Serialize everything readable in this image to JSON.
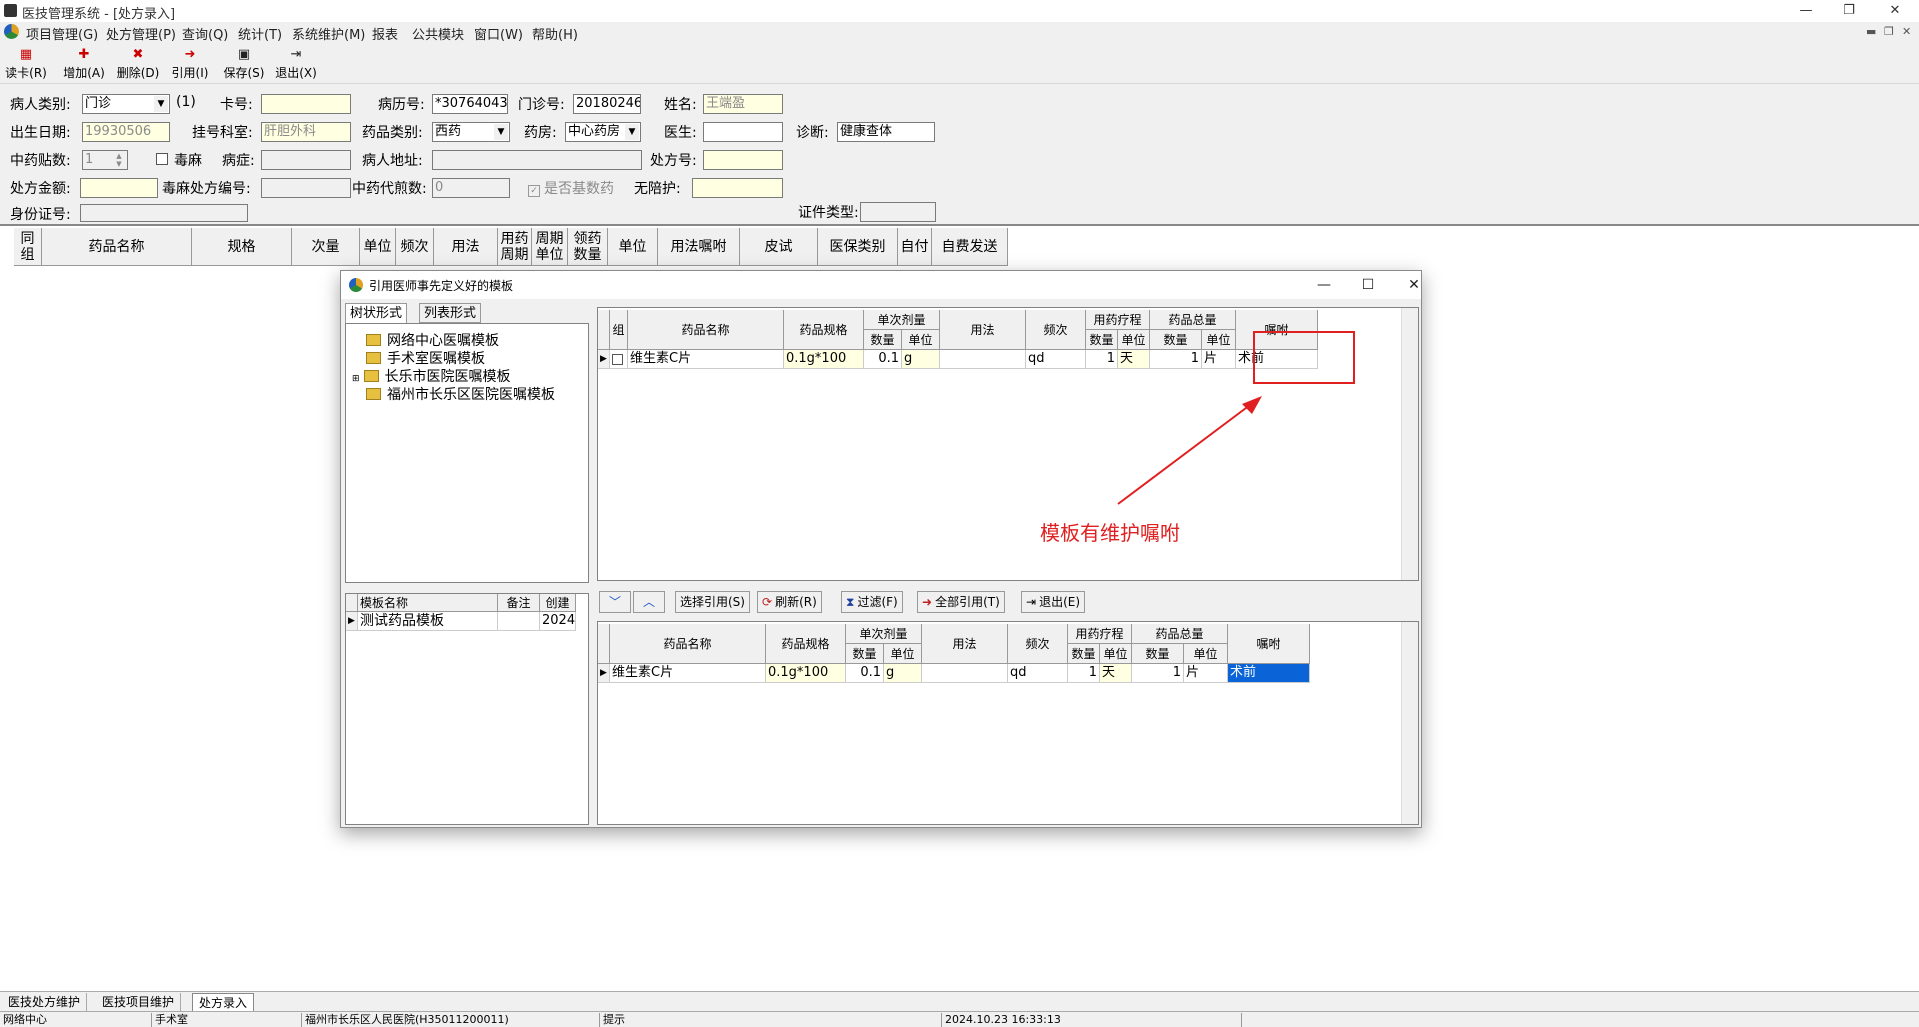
{
  "window": {
    "title": "医技管理系统 - [处方录入]"
  },
  "menu": [
    "项目管理(G)",
    "处方管理(P)",
    "查询(Q)",
    "统计(T)",
    "系统维护(M)",
    "报表",
    "公共模块",
    "窗口(W)",
    "帮助(H)"
  ],
  "toolbar": {
    "read_card": "读卡(R)",
    "add": "增加(A)",
    "delete": "删除(D)",
    "quote": "引用(I)",
    "save": "保存(S)",
    "exit": "退出(X)"
  },
  "form": {
    "patient_type_label": "病人类别:",
    "patient_type": "门诊",
    "patient_type_extra": "(1)",
    "card_no_label": "卡号:",
    "card_no": "",
    "record_no_label": "病历号:",
    "record_no": "*30764043",
    "clinic_no_label": "门诊号:",
    "clinic_no": "20180246",
    "name_label": "姓名:",
    "name": "王端盈",
    "birth_label": "出生日期:",
    "birth": "19930506",
    "dept_label": "挂号科室:",
    "dept": "肝胆外科",
    "drug_type_label": "药品类别:",
    "drug_type": "西药",
    "pharmacy_label": "药房:",
    "pharmacy": "中心药房",
    "doctor_label": "医生:",
    "doctor": "",
    "diagnosis_label": "诊断:",
    "diagnosis": "健康查体",
    "herbal_count_label": "中药贴数:",
    "herbal_count": "1",
    "narcotic_label": "毒麻",
    "symptom_label": "病症:",
    "symptom": "",
    "address_label": "病人地址:",
    "address": "",
    "rx_no_label": "处方号:",
    "rx_no": "",
    "rx_amount_label": "处方金额:",
    "rx_amount": "",
    "narcotic_rx_label": "毒麻处方编号:",
    "narcotic_rx": "",
    "decoct_label": "中药代煎数:",
    "decoct": "0",
    "basic_drug_label": "是否基数药",
    "no_escort_label": "无陪护:",
    "no_escort": "",
    "id_label": "身份证号:",
    "id_no": "",
    "cert_type_label": "证件类型:",
    "cert_type": ""
  },
  "main_grid_headers": [
    "同组",
    "药品名称",
    "规格",
    "次量",
    "单位",
    "频次",
    "用法",
    "用药周期",
    "周期单位",
    "领药数量",
    "单位",
    "用法嘱咐",
    "皮试",
    "医保类别",
    "自付",
    "自费发送"
  ],
  "dialog": {
    "title": "引用医师事先定义好的模板",
    "tab_tree": "树状形式",
    "tab_list": "列表形式",
    "tree": [
      "网络中心医嘱模板",
      "手术室医嘱模板",
      "长乐市医院医嘱模板",
      "福州市长乐区医院医嘱模板"
    ],
    "tpl_headers": [
      "模板名称",
      "备注",
      "创建"
    ],
    "tpl_rows": [
      [
        "测试药品模板",
        "",
        "2024"
      ]
    ],
    "grid_headers": {
      "group": "组",
      "name": "药品名称",
      "spec": "药品规格",
      "single_dose": "单次剂量",
      "qty": "数量",
      "unit": "单位",
      "usage": "用法",
      "freq": "频次",
      "course": "用药疗程",
      "total": "药品总量",
      "advice": "嘱咐"
    },
    "row": {
      "name": "维生素C片",
      "spec": "0.1g*100",
      "dose": "0.1",
      "dose_unit": "g",
      "usage": "",
      "freq": "qd",
      "course": "1",
      "course_unit": "天",
      "total": "1",
      "total_unit": "片",
      "advice": "术前"
    },
    "buttons": {
      "select": "选择引用(S)",
      "refresh": "刷新(R)",
      "filter": "过滤(F)",
      "quote_all": "全部引用(T)",
      "exit": "退出(E)"
    }
  },
  "annotation": {
    "text": "模板有维护嘱咐"
  },
  "bottom_tabs": [
    "医技处方维护",
    "医技项目维护",
    "处方录入"
  ],
  "status": [
    "网络中心",
    "手术室",
    "福州市长乐区人民医院(H35011200011)",
    "提示",
    "2024.10.23 16:33:13"
  ]
}
